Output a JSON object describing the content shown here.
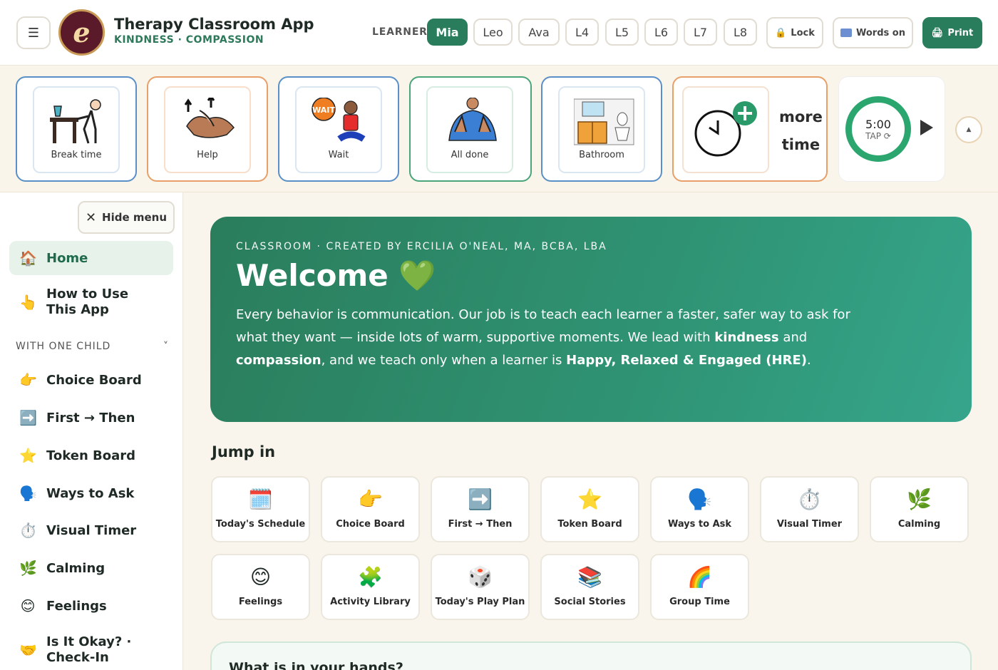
{
  "header": {
    "app_title": "Therapy Classroom App",
    "app_subtitle": "KINDNESS · COMPASSION",
    "logo_letter": "e",
    "learner_label": "LEARNER",
    "learners": [
      "Mia",
      "Leo",
      "Ava",
      "L4",
      "L5",
      "L6",
      "L7",
      "L8"
    ],
    "active_learner": "Mia",
    "lock_label": "Lock",
    "words_label": "Words on",
    "print_label": "Print"
  },
  "quick_cards": [
    {
      "label": "Break time",
      "icon": "break-time-icon",
      "color": "#5b8fc7"
    },
    {
      "label": "Help",
      "icon": "help-hands-icon",
      "color": "#e8a06a"
    },
    {
      "label": "Wait",
      "icon": "wait-icon",
      "color": "#5b8fc7"
    },
    {
      "label": "All done",
      "icon": "all-done-icon",
      "color": "#4aa57a"
    },
    {
      "label": "Bathroom",
      "icon": "bathroom-icon",
      "color": "#5b8fc7"
    }
  ],
  "more_time": {
    "line1": "more",
    "line2": "time"
  },
  "timer": {
    "value": "5:00",
    "tap": "TAP ⟳"
  },
  "sidebar": {
    "hide_label": "Hide menu",
    "items_top": [
      {
        "label": "Home",
        "icon": "🏠"
      },
      {
        "label": "How to Use This App",
        "icon": "👆"
      }
    ],
    "section_label": "WITH ONE CHILD",
    "section_chevron": "˅",
    "items": [
      {
        "label": "Choice Board",
        "icon": "👉"
      },
      {
        "label": "First → Then",
        "icon": "➡️"
      },
      {
        "label": "Token Board",
        "icon": "⭐"
      },
      {
        "label": "Ways to Ask",
        "icon": "🗣️"
      },
      {
        "label": "Visual Timer",
        "icon": "⏱️"
      },
      {
        "label": "Calming",
        "icon": "🌿"
      },
      {
        "label": "Feelings",
        "icon": "😊"
      },
      {
        "label": "Is It Okay? · Check-In",
        "icon": "🤝"
      }
    ]
  },
  "hero": {
    "eyebrow": "CLASSROOM · CREATED BY ERCILIA O'NEAL, MA, BCBA, LBA",
    "title": "Welcome",
    "title_emoji": "💚",
    "body_1": "Every behavior is communication. Our job is to teach each learner a faster, safer way to ask for what they want — inside lots of warm, supportive moments. We lead with ",
    "body_b1": "kindness",
    "body_2": " and ",
    "body_b2": "compassion",
    "body_3": ", and we teach only when a learner is ",
    "body_b3": "Happy, Relaxed & Engaged (HRE)",
    "body_4": "."
  },
  "jump_in": {
    "title": "Jump in",
    "tiles": [
      {
        "label": "Today's Schedule",
        "icon": "🗓️"
      },
      {
        "label": "Choice Board",
        "icon": "👉"
      },
      {
        "label": "First → Then",
        "icon": "➡️"
      },
      {
        "label": "Token Board",
        "icon": "⭐"
      },
      {
        "label": "Ways to Ask",
        "icon": "🗣️"
      },
      {
        "label": "Visual Timer",
        "icon": "⏱️"
      },
      {
        "label": "Calming",
        "icon": "🌿"
      },
      {
        "label": "Feelings",
        "icon": "😊"
      },
      {
        "label": "Activity Library",
        "icon": "🧩"
      },
      {
        "label": "Today's Play Plan",
        "icon": "🎲"
      },
      {
        "label": "Social Stories",
        "icon": "📚"
      },
      {
        "label": "Group Time",
        "icon": "🌈"
      }
    ]
  },
  "hands_card": {
    "title": "What is in your hands?"
  }
}
